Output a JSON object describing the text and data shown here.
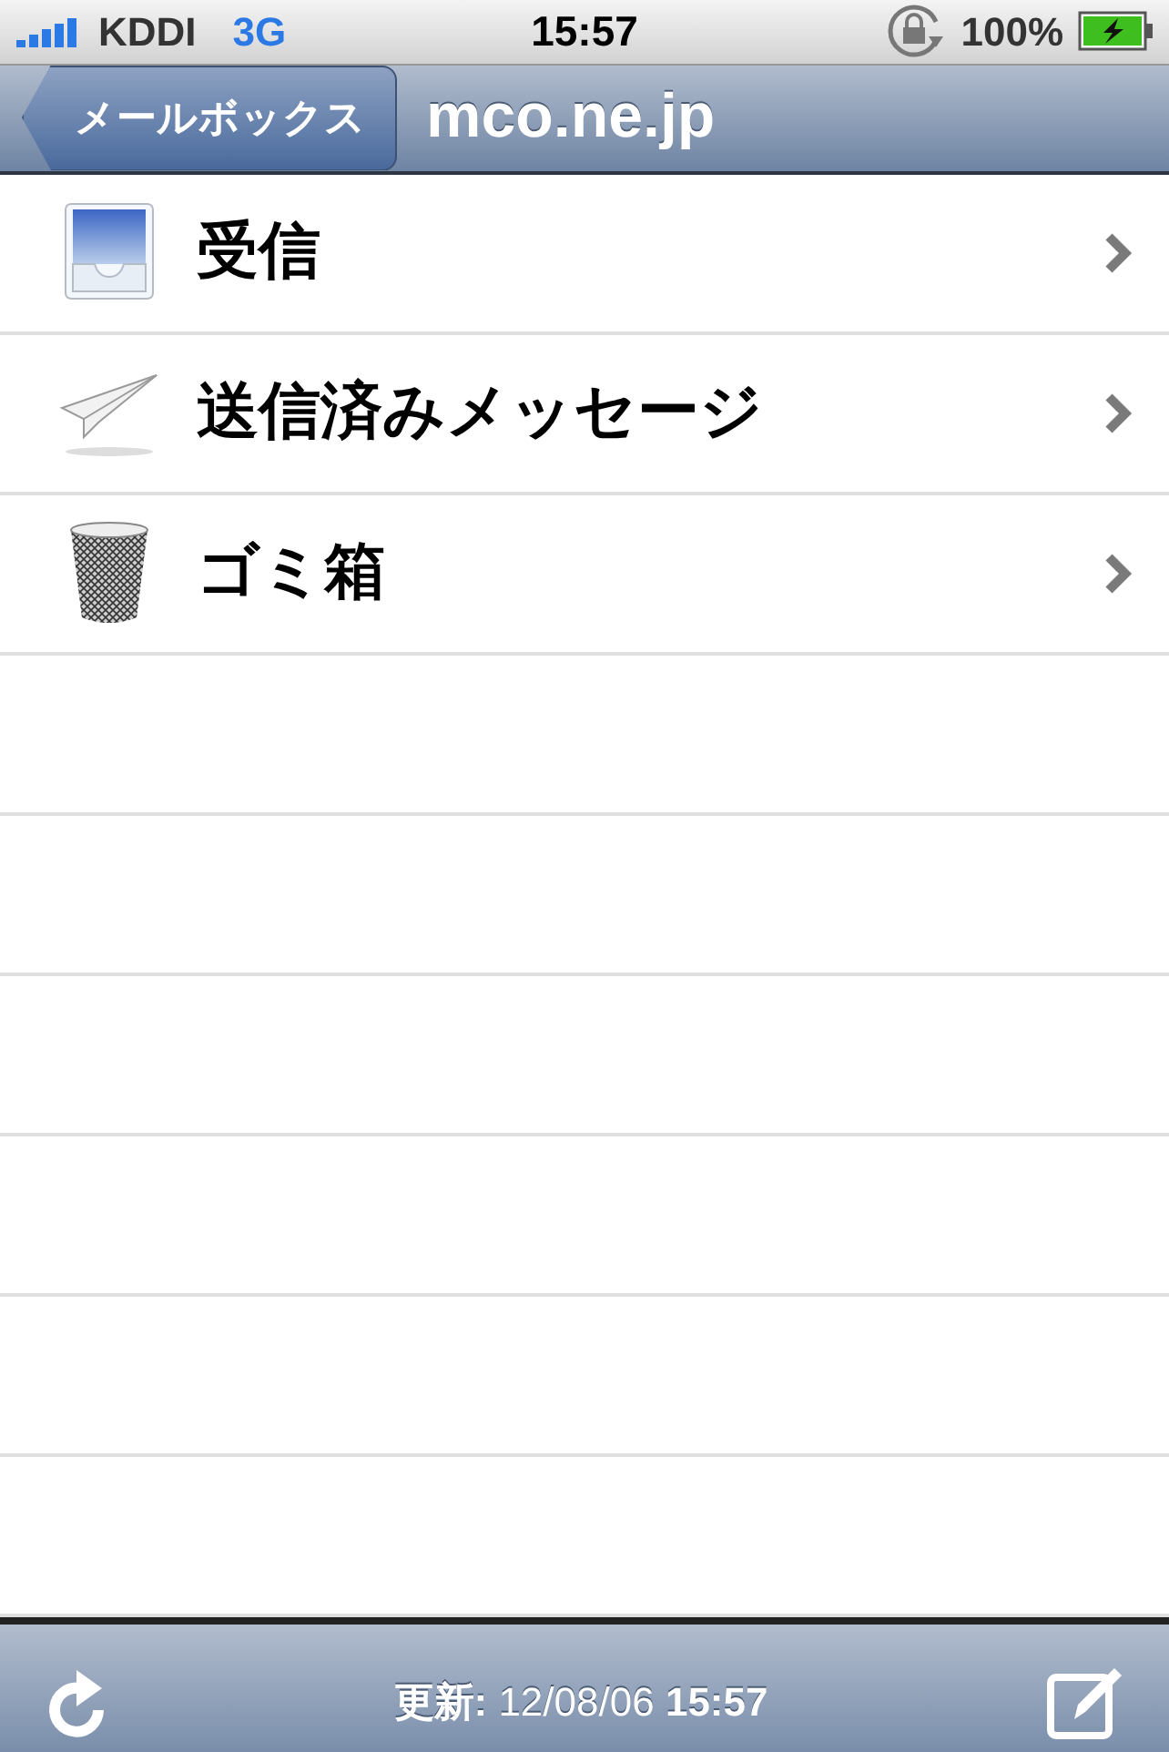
{
  "status_bar": {
    "carrier": "KDDI",
    "network": "3G",
    "time": "15:57",
    "battery": "100%"
  },
  "nav_bar": {
    "back": "メールボックス",
    "title": "mco.ne.jp"
  },
  "mailboxes": [
    {
      "kind": "inbox",
      "label": "受信"
    },
    {
      "kind": "sent",
      "label": "送信済みメッセージ"
    },
    {
      "kind": "trash",
      "label": "ゴミ箱"
    }
  ],
  "toolbar": {
    "updated": "**更新:** 12/08/06 **15:57**"
  }
}
